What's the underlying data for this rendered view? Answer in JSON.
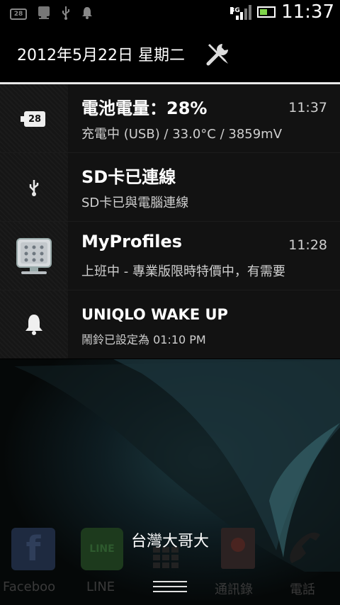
{
  "status_bar": {
    "battery_mini_level": "28",
    "network_type": "3G",
    "time": "11:37",
    "icons": [
      "battery-level-icon",
      "profile-icon",
      "usb-icon",
      "alarm-icon",
      "signal-icon",
      "battery-charging-icon"
    ]
  },
  "header": {
    "date": "2012年5月22日 星期二",
    "settings_icon": "tools-icon"
  },
  "notifications": [
    {
      "icon": "battery-28-icon",
      "icon_text": "28",
      "title": "電池電量：28%",
      "subtitle": "充電中 (USB) / 33.0°C / 3859mV",
      "time": "11:37"
    },
    {
      "icon": "usb-icon",
      "title": "SD卡已連線",
      "subtitle": "SD卡已與電腦連線",
      "time": ""
    },
    {
      "icon": "profile-icon",
      "title": "MyProfiles",
      "subtitle": "上班中 - 專業版限時特價中，有需要",
      "time": "11:28"
    },
    {
      "icon": "alarm-icon",
      "title": "UNIQLO WAKE UP",
      "subtitle": "鬧鈴已設定為 01:10 PM",
      "time": ""
    }
  ],
  "homescreen": {
    "carrier": "台灣大哥大",
    "dock": [
      {
        "label": "Faceboo",
        "icon": "facebook-icon",
        "icon_text": "f",
        "color": "#3b5998"
      },
      {
        "label": "LINE",
        "icon": "line-icon",
        "icon_text": "LINE",
        "color": "#3fbf3f"
      },
      {
        "label": "",
        "icon": "app-drawer-icon"
      },
      {
        "label": "通訊錄",
        "icon": "contacts-icon",
        "color": "#c94434"
      },
      {
        "label": "電話",
        "icon": "phone-icon"
      }
    ]
  }
}
